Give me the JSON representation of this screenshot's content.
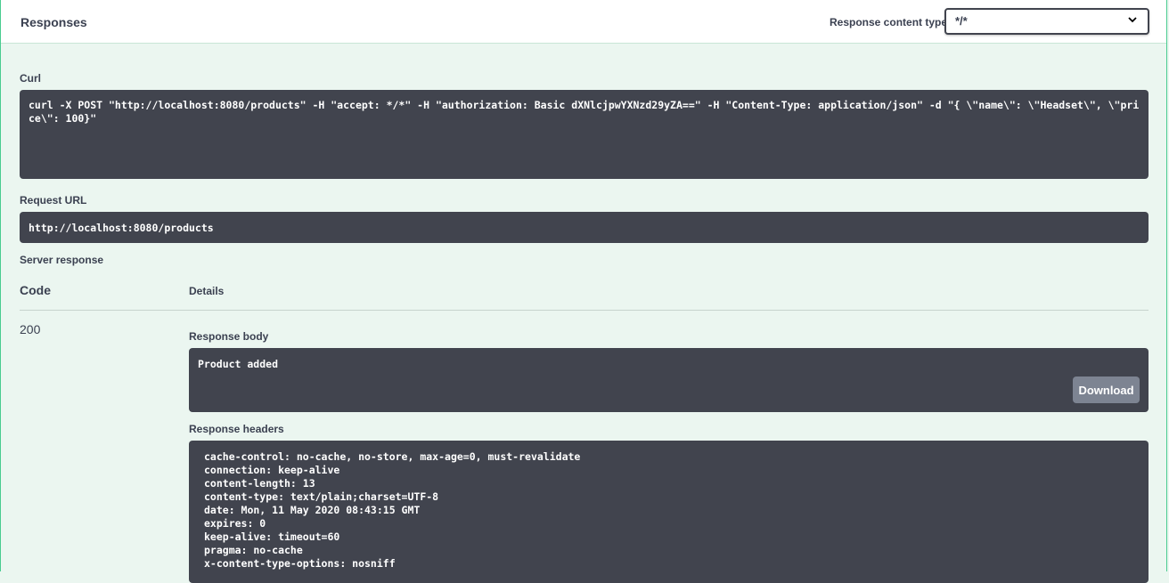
{
  "responses": {
    "title": "Responses",
    "content_type_label": "Response content type",
    "content_type_value": "*/*",
    "icon": "chevron-down-icon"
  },
  "curl": {
    "label": "Curl",
    "command": "curl -X POST \"http://localhost:8080/products\" -H \"accept: */*\" -H \"authorization: Basic dXNlcjpwYXNzd29yZA==\" -H \"Content-Type: application/json\" -d \"{ \\\"name\\\": \\\"Headset\\\", \\\"price\\\": 100}\""
  },
  "request_url": {
    "label": "Request URL",
    "value": "http://localhost:8080/products"
  },
  "server_response": {
    "label": "Server response",
    "code_header": "Code",
    "details_header": "Details",
    "code": "200",
    "body_label": "Response body",
    "body": "Product added",
    "download_label": "Download",
    "headers_label": "Response headers",
    "headers": [
      "cache-control: no-cache, no-store, max-age=0, must-revalidate",
      "connection: keep-alive",
      "content-length: 13",
      "content-type: text/plain;charset=UTF-8",
      "date: Mon, 11 May 2020 08:43:15 GMT",
      "expires: 0",
      "keep-alive: timeout=60",
      "pragma: no-cache",
      "x-content-type-options: nosniff"
    ]
  },
  "colors": {
    "background": "#ebf6f0",
    "border": "#49cc90",
    "code_bg": "#41444e",
    "button_bg": "#7d8492",
    "text": "#3b4151"
  }
}
